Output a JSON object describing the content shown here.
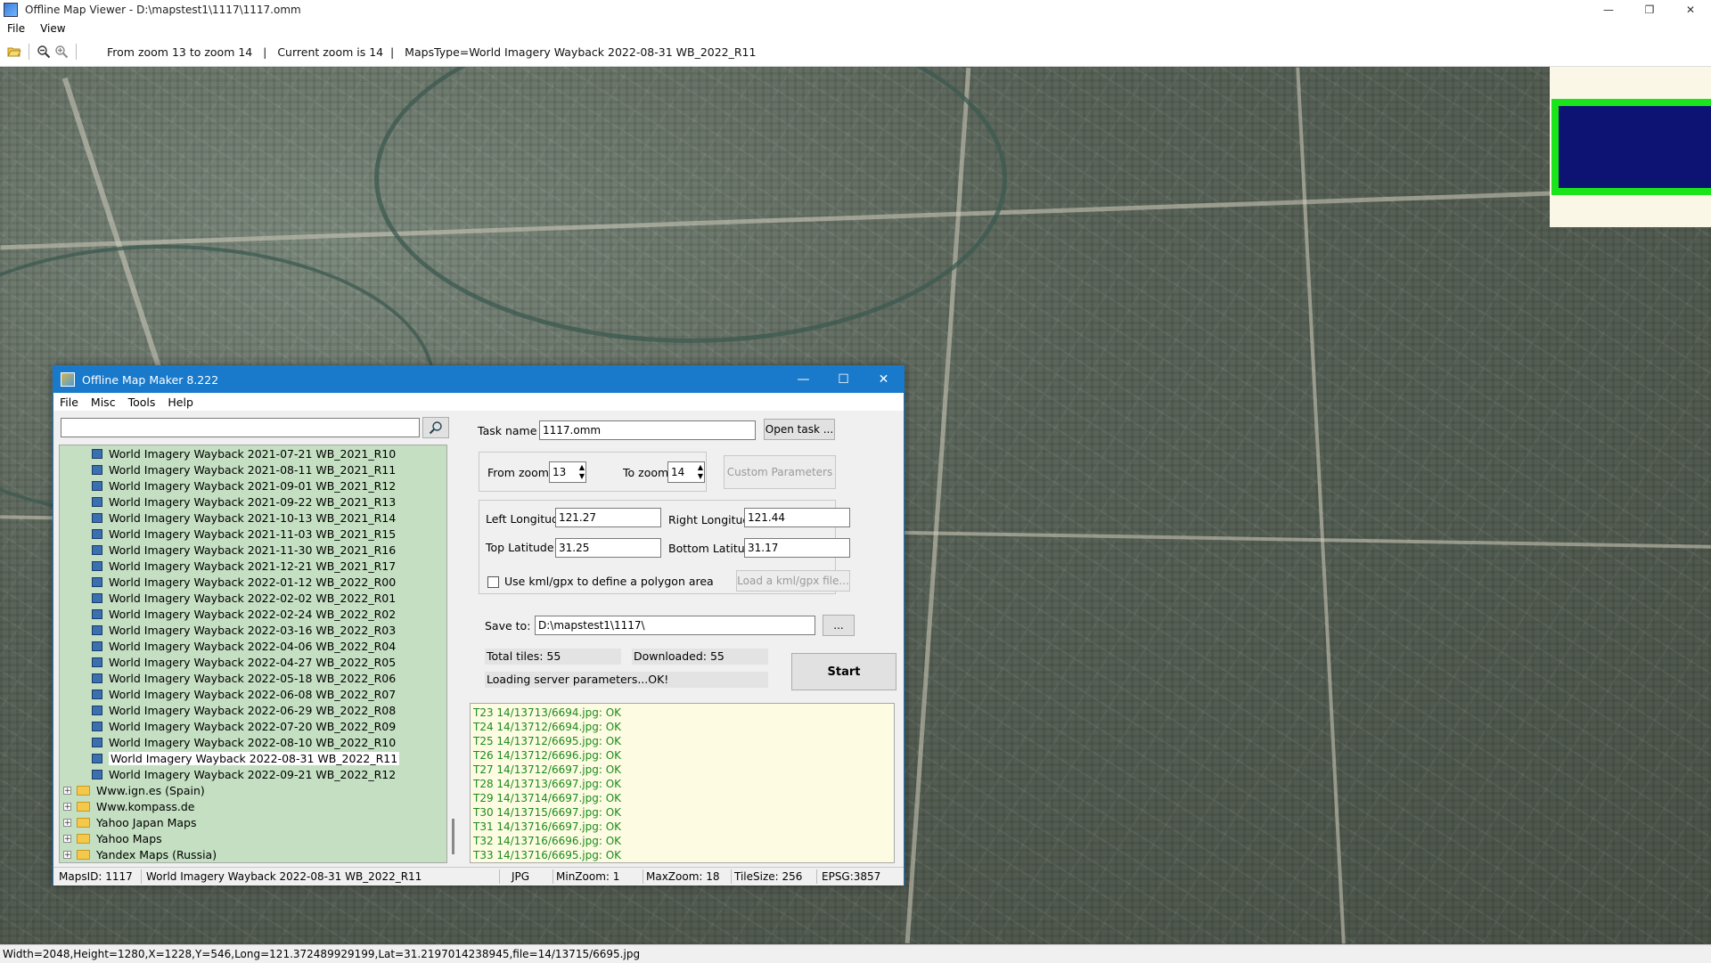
{
  "window": {
    "title": "Offline Map Viewer - D:\\mapstest1\\1117\\1117.omm",
    "minimize": "—",
    "maximize": "❐",
    "close": "✕"
  },
  "menu": [
    "File",
    "View"
  ],
  "toolbar": {
    "info": "From zoom 13 to zoom 14   |   Current zoom is 14  |   MapsType=World Imagery Wayback 2022-08-31 WB_2022_R11"
  },
  "status": {
    "text": "Width=2048,Height=1280,X=1228,Y=546,Long=121.372489929199,Lat=31.2197014238945,file=14/13715/6695.jpg"
  },
  "overview": {
    "frame_color": "#19e51a",
    "fill_color": "#0d1372"
  },
  "dialog": {
    "title": "Offline Map Maker 8.222",
    "menu": [
      "File",
      "Misc",
      "Tools",
      "Help"
    ],
    "search": {
      "value": "",
      "icon": "search-icon"
    },
    "tree_items": [
      "World Imagery Wayback 2021-07-21 WB_2021_R10",
      "World Imagery Wayback 2021-08-11 WB_2021_R11",
      "World Imagery Wayback 2021-09-01 WB_2021_R12",
      "World Imagery Wayback 2021-09-22 WB_2021_R13",
      "World Imagery Wayback 2021-10-13 WB_2021_R14",
      "World Imagery Wayback 2021-11-03 WB_2021_R15",
      "World Imagery Wayback 2021-11-30 WB_2021_R16",
      "World Imagery Wayback 2021-12-21 WB_2021_R17",
      "World Imagery Wayback 2022-01-12 WB_2022_R00",
      "World Imagery Wayback 2022-02-02 WB_2022_R01",
      "World Imagery Wayback 2022-02-24 WB_2022_R02",
      "World Imagery Wayback 2022-03-16 WB_2022_R03",
      "World Imagery Wayback 2022-04-06 WB_2022_R04",
      "World Imagery Wayback 2022-04-27 WB_2022_R05",
      "World Imagery Wayback 2022-05-18 WB_2022_R06",
      "World Imagery Wayback 2022-06-08 WB_2022_R07",
      "World Imagery Wayback 2022-06-29 WB_2022_R08",
      "World Imagery Wayback 2022-07-20 WB_2022_R09",
      "World Imagery Wayback 2022-08-10 WB_2022_R10",
      "World Imagery Wayback 2022-08-31 WB_2022_R11",
      "World Imagery Wayback 2022-09-21 WB_2022_R12"
    ],
    "selected_item": "World Imagery Wayback 2022-08-31 WB_2022_R11",
    "tree_folders": [
      "Www.ign.es (Spain)",
      "Www.kompass.de",
      "Yahoo Japan Maps",
      "Yahoo Maps",
      "Yandex Maps (Russia)"
    ],
    "task_name_label": "Task name",
    "task_name": "1117.omm",
    "open_task": "Open task ...",
    "from_zoom_label": "From zoom",
    "from_zoom": "13",
    "to_zoom_label": "To zoom",
    "to_zoom": "14",
    "custom_params": "Custom Parameters",
    "left_lon_label": "Left Longitude",
    "left_lon": "121.27",
    "right_lon_label": "Right Longitude",
    "right_lon": "121.44",
    "top_lat_label": "Top Latitude",
    "top_lat": "31.25",
    "bottom_lat_label": "Bottom Latitude",
    "bottom_lat": "31.17",
    "kml_label": "Use kml/gpx to define a polygon area",
    "kml_checked": false,
    "load_kml": "Load a kml/gpx file...",
    "save_to_label": "Save to:",
    "save_to": "D:\\mapstest1\\1117\\",
    "browse": "...",
    "total_tiles": "Total tiles: 55",
    "downloaded": "Downloaded: 55",
    "loading": "Loading server parameters...OK!",
    "start": "Start",
    "log": [
      "T23 14/13713/6694.jpg: OK",
      "T24 14/13712/6694.jpg: OK",
      "T25 14/13712/6695.jpg: OK",
      "T26 14/13712/6696.jpg: OK",
      "T27 14/13712/6697.jpg: OK",
      "T28 14/13713/6697.jpg: OK",
      "T29 14/13714/6697.jpg: OK",
      "T30 14/13715/6697.jpg: OK",
      "T31 14/13716/6697.jpg: OK",
      "T32 14/13716/6696.jpg: OK",
      "T33 14/13716/6695.jpg: OK"
    ],
    "statusbar": {
      "maps_id": "MapsID: 1117",
      "map_name": "World Imagery Wayback 2022-08-31 WB_2022_R11",
      "format": "JPG",
      "min_zoom": "MinZoom: 1",
      "max_zoom": "MaxZoom: 18",
      "tile_size": "TileSize: 256",
      "epsg": "EPSG:3857"
    }
  }
}
